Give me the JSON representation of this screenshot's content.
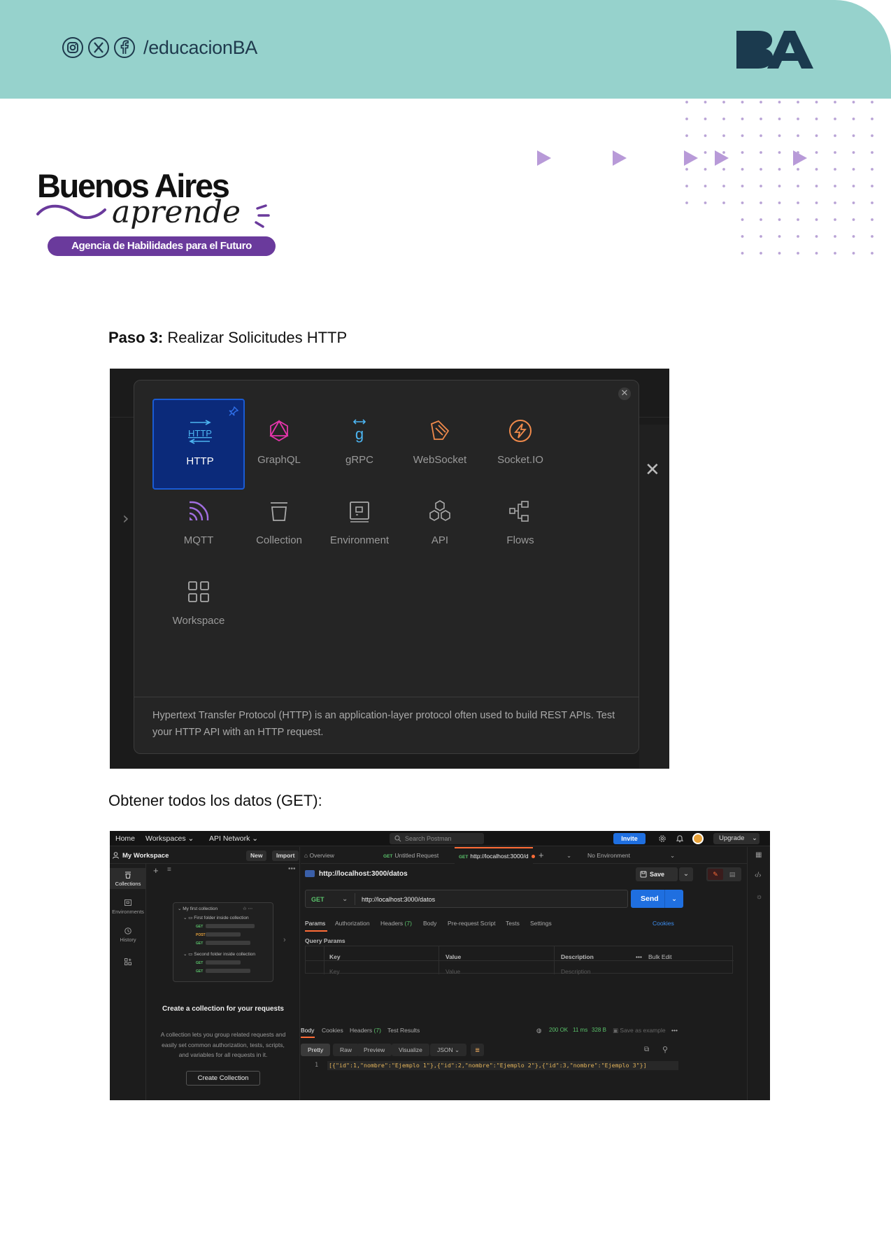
{
  "header": {
    "social_handle": "/educacionBA",
    "social_icons": [
      "instagram-icon",
      "x-twitter-icon",
      "facebook-icon"
    ],
    "ba_logo_text": "BA",
    "band_color": "#96d2cc"
  },
  "brand": {
    "title": "Buenos Aires",
    "script": "aprende",
    "tagline": "Agencia de Habilidades para el Futuro",
    "accent": "#6a3a9c"
  },
  "step": {
    "label": "Paso 3:",
    "text": "Realizar Solicitudes HTTP"
  },
  "new_modal": {
    "items": [
      {
        "label": "HTTP",
        "icon": "http-icon",
        "selected": true
      },
      {
        "label": "GraphQL",
        "icon": "graphql-icon"
      },
      {
        "label": "gRPC",
        "icon": "grpc-icon"
      },
      {
        "label": "WebSocket",
        "icon": "websocket-icon"
      },
      {
        "label": "Socket.IO",
        "icon": "socketio-icon"
      },
      {
        "label": "MQTT",
        "icon": "mqtt-icon"
      },
      {
        "label": "Collection",
        "icon": "collection-icon"
      },
      {
        "label": "Environment",
        "icon": "environment-icon"
      },
      {
        "label": "API",
        "icon": "api-icon"
      },
      {
        "label": "Flows",
        "icon": "flows-icon"
      },
      {
        "label": "Workspace",
        "icon": "workspace-icon"
      }
    ],
    "description": "Hypertext Transfer Protocol (HTTP) is an application-layer protocol often used to build REST APIs. Test your HTTP API with an HTTP request."
  },
  "get_section": {
    "title": "Obtener todos los datos (GET):"
  },
  "postman": {
    "nav": {
      "home": "Home",
      "workspaces": "Workspaces",
      "api_network": "API Network",
      "search_placeholder": "Search Postman",
      "invite": "Invite",
      "upgrade": "Upgrade"
    },
    "sidebar": {
      "workspace": "My Workspace",
      "new": "New",
      "import": "Import",
      "rail": [
        "Collections",
        "Environments",
        "History"
      ],
      "card": {
        "collection": "My first collection",
        "folder1": "First folder inside collection",
        "folder2": "Second folder inside collection",
        "methods": [
          "GET",
          "POST",
          "GET",
          "GET",
          "GET"
        ]
      },
      "create_title": "Create a collection for your requests",
      "create_desc": "A collection lets you group related requests and easily set common authorization, tests, scripts, and variables for all requests in it.",
      "create_button": "Create Collection"
    },
    "tabs": {
      "overview": "Overview",
      "untitled": "Untitled Request",
      "active": "http://localhost:3000/d",
      "method": "GET",
      "env": "No Environment"
    },
    "request": {
      "title": "http://localhost:3000/datos",
      "method": "GET",
      "url": "http://localhost:3000/datos",
      "save": "Save",
      "send": "Send",
      "subtabs": [
        "Params",
        "Authorization",
        "Headers",
        "Body",
        "Pre-request Script",
        "Tests",
        "Settings"
      ],
      "headers_count": "(7)",
      "cookies": "Cookies",
      "query_params": "Query Params",
      "columns": [
        "Key",
        "Value",
        "Description"
      ],
      "placeholders": [
        "Key",
        "Value",
        "Description"
      ],
      "bulk_edit": "Bulk Edit"
    },
    "response": {
      "tabs": [
        "Body",
        "Cookies",
        "Headers",
        "Test Results"
      ],
      "headers_count": "(7)",
      "status": "200 OK",
      "time": "11 ms",
      "size": "328 B",
      "save_example": "Save as example",
      "formats": [
        "Pretty",
        "Raw",
        "Preview",
        "Visualize"
      ],
      "lang": "JSON",
      "line_number": "1",
      "body": "[{\"id\":1,\"nombre\":\"Ejemplo 1\"},{\"id\":2,\"nombre\":\"Ejemplo 2\"},{\"id\":3,\"nombre\":\"Ejemplo 3\"}]"
    }
  }
}
